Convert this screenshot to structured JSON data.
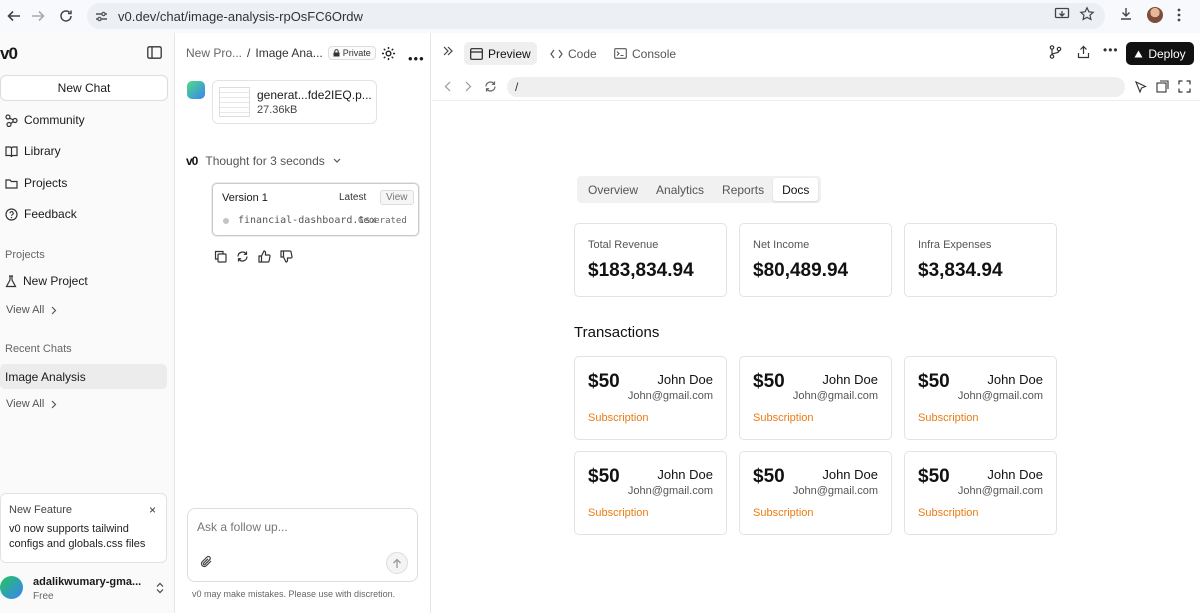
{
  "browser": {
    "url": "v0.dev/chat/image-analysis-rpOsFC6Ordw"
  },
  "sidebar": {
    "logo": "v0",
    "new_chat": "New Chat",
    "nav": [
      {
        "label": "Community",
        "icon": "community-icon"
      },
      {
        "label": "Library",
        "icon": "book-icon"
      },
      {
        "label": "Projects",
        "icon": "folder-icon"
      },
      {
        "label": "Feedback",
        "icon": "help-circle-icon"
      }
    ],
    "projects_heading": "Projects",
    "new_project": "New Project",
    "view_all_projects": "View All",
    "recent_heading": "Recent Chats",
    "recent_active": "Image Analysis",
    "view_all_chats": "View All",
    "feature": {
      "title": "New Feature",
      "body": "v0 now supports tailwind configs and globals.css files",
      "close": "×"
    },
    "user": {
      "name": "adalikwumary-gma...",
      "plan": "Free"
    }
  },
  "chat": {
    "breadcrumb_project": "New Pro...",
    "breadcrumb_sep": "/",
    "breadcrumb_chat": "Image Ana...",
    "privacy": "Private",
    "attachment": {
      "name": "generat...fde2IEQ.p...",
      "size": "27.36kB"
    },
    "thought": "Thought for 3 seconds",
    "version": {
      "title": "Version 1",
      "tag": "Latest",
      "view": "View",
      "file": "financial-dashboard.tsx",
      "status": "Generated"
    },
    "composer_placeholder": "Ask a follow up...",
    "disclaimer": "v0 may make mistakes. Please use with discretion."
  },
  "preview": {
    "tabs": [
      "Preview",
      "Code",
      "Console"
    ],
    "deploy": "Deploy",
    "address": "/"
  },
  "dashboard": {
    "tabs": [
      "Overview",
      "Analytics",
      "Reports",
      "Docs"
    ],
    "active_tab": "Docs",
    "stats": [
      {
        "label": "Total Revenue",
        "value": "$183,834.94"
      },
      {
        "label": "Net Income",
        "value": "$80,489.94"
      },
      {
        "label": "Infra Expenses",
        "value": "$3,834.94"
      }
    ],
    "transactions_heading": "Transactions",
    "transactions": [
      {
        "amount": "$50",
        "name": "John Doe",
        "email": "John@gmail.com",
        "type": "Subscription"
      },
      {
        "amount": "$50",
        "name": "John Doe",
        "email": "John@gmail.com",
        "type": "Subscription"
      },
      {
        "amount": "$50",
        "name": "John Doe",
        "email": "John@gmail.com",
        "type": "Subscription"
      },
      {
        "amount": "$50",
        "name": "John Doe",
        "email": "John@gmail.com",
        "type": "Subscription"
      },
      {
        "amount": "$50",
        "name": "John Doe",
        "email": "John@gmail.com",
        "type": "Subscription"
      },
      {
        "amount": "$50",
        "name": "John Doe",
        "email": "John@gmail.com",
        "type": "Subscription"
      }
    ],
    "accent_color": "#ea7c14"
  }
}
